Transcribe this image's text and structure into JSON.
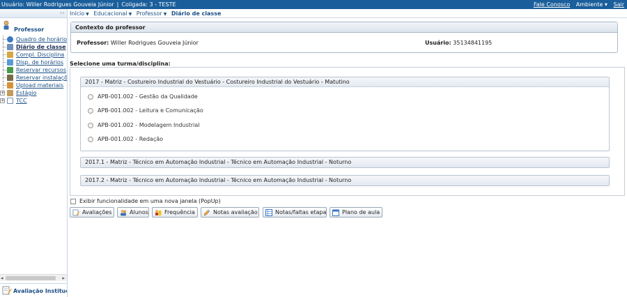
{
  "topbar": {
    "usuario": "Usuário: Willer Rodrigues Gouveia Júnior",
    "coligada": "Coligada: 3 - TESTE",
    "fale_conosco": "Fale Conosco",
    "ambiente": "Ambiente ▾",
    "sair": "Sair"
  },
  "sidebar": {
    "title": "Professor",
    "items": [
      {
        "label": "Quadro de horários"
      },
      {
        "label": "Diário de classe"
      },
      {
        "label": "Compl. Disciplina"
      },
      {
        "label": "Disp. de horários"
      },
      {
        "label": "Reservar recursos"
      },
      {
        "label": "Reservar instalações"
      },
      {
        "label": "Upload materiais"
      },
      {
        "label": "Estágio"
      },
      {
        "label": "TCC"
      }
    ],
    "footer": "Avaliação Institucional"
  },
  "breadcrumb": {
    "inicio": "Início",
    "educacional": "Educacional",
    "professor": "Professor",
    "current": "Diário de classe"
  },
  "context": {
    "title": "Contexto do professor",
    "professor_label": "Professor:",
    "professor_value": "Willer Rodrigues Gouveia Júnior",
    "usuario_label": "Usuário:",
    "usuario_value": "35134841195"
  },
  "select_label": "Selecione uma turma/disciplina:",
  "groups": [
    {
      "title": "2017 - Matriz - Costureiro Industrial do Vestuário - Costureiro Industrial do Vestuário - Matutino",
      "options": [
        "APB-001.002 - Gestão da Qualidade",
        "APB-001.002 - Leitura e Comunicação",
        "APB-001.002 - Modelagem Industrial",
        "APB-001.002 - Redação"
      ]
    },
    {
      "title": "2017.1 - Matriz - Técnico em Automação Industrial - Técnico em Automação Industrial - Noturno"
    },
    {
      "title": "2017.2 - Matriz - Técnico em Automação Industrial - Técnico em Automação Industrial - Noturno"
    }
  ],
  "popup_checkbox": "Exibir funcionalidade em uma nova janela (PopUp)",
  "buttons": {
    "avaliacoes": "Avaliações",
    "alunos": "Alunos",
    "frequencia": "Frequência",
    "notas_avaliacao": "Notas avaliação",
    "notas_faltas_etapa": "Notas/faltas etapa",
    "plano_de_aula": "Plano de aula"
  },
  "colors": {
    "topbar": "#1a5e9b",
    "link": "#1a4f85"
  }
}
